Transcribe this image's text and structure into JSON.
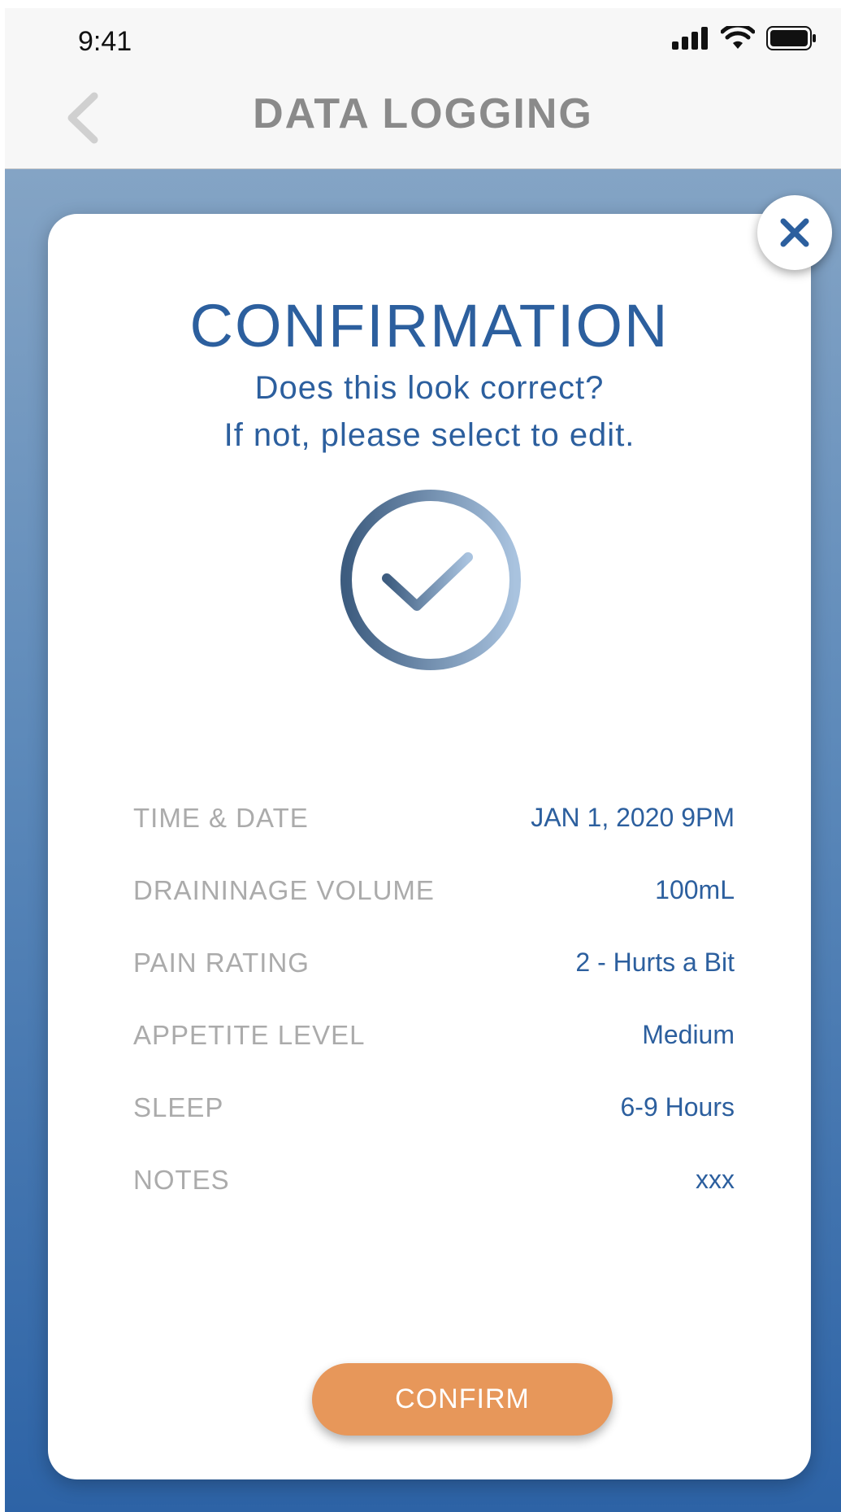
{
  "status_bar": {
    "time": "9:41",
    "icons": [
      "signal-icon",
      "wifi-icon",
      "battery-icon"
    ]
  },
  "nav": {
    "title": "DATA LOGGING",
    "back_icon": "chevron-left-icon"
  },
  "modal": {
    "close_icon": "close-icon",
    "title": "CONFIRMATION",
    "subtitle_line1": "Does this look correct?",
    "subtitle_line2": "If not, please select to edit.",
    "status_icon": "check-circle-icon",
    "rows": [
      {
        "label": "TIME & DATE",
        "value": "JAN 1, 2020 9PM"
      },
      {
        "label": "DRAININAGE VOLUME",
        "value": "100mL"
      },
      {
        "label": "PAIN RATING",
        "value": "2 - Hurts a Bit"
      },
      {
        "label": "APPETITE LEVEL",
        "value": "Medium"
      },
      {
        "label": "SLEEP",
        "value": "6-9 Hours"
      },
      {
        "label": "NOTES",
        "value": "xxx"
      }
    ],
    "confirm_label": "CONFIRM"
  },
  "colors": {
    "accent_blue": "#2c5f9e",
    "label_gray": "#ababab",
    "confirm_orange": "#e7975a",
    "nav_title_gray": "#8a8a8a"
  }
}
